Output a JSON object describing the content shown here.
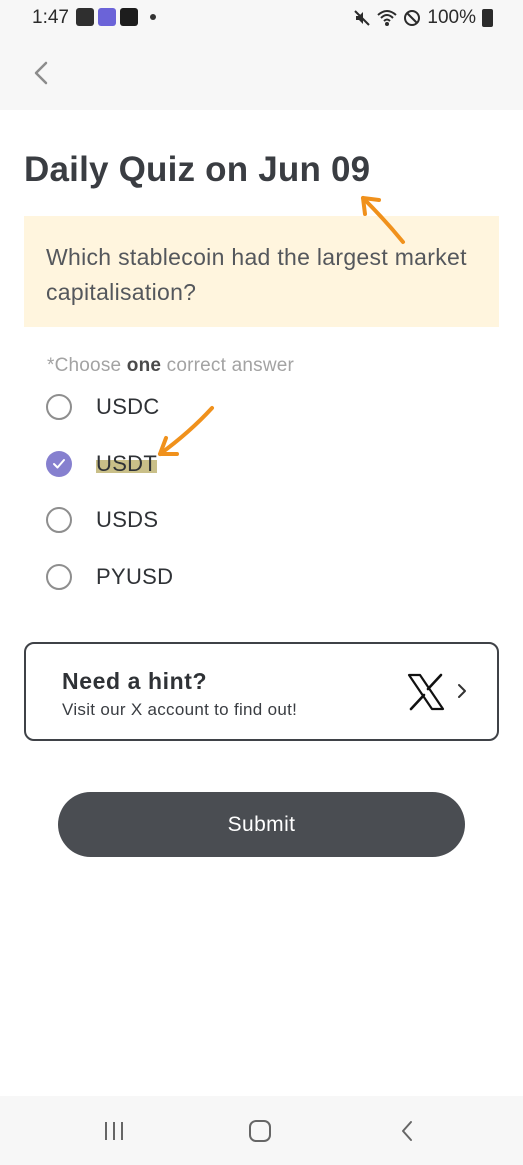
{
  "status_bar": {
    "time": "1:47",
    "battery": "100%",
    "icons_left": [
      "gallery-icon",
      "app-icon",
      "app-icon",
      "dot-icon"
    ],
    "icons_right": [
      "mute-icon",
      "wifi-icon",
      "dnd-icon",
      "battery-icon"
    ]
  },
  "header": {
    "back_icon": "chevron-left-icon"
  },
  "quiz": {
    "title": "Daily Quiz on Jun 09",
    "question": "Which stablecoin had the largest market capitalisation?",
    "instruction_prefix": "*Choose ",
    "instruction_emphasis": "one",
    "instruction_suffix": " correct answer",
    "options": [
      {
        "label": "USDC",
        "selected": false
      },
      {
        "label": "USDT",
        "selected": true
      },
      {
        "label": "USDS",
        "selected": false
      },
      {
        "label": "PYUSD",
        "selected": false
      }
    ]
  },
  "hint": {
    "title": "Need a hint?",
    "subtitle": "Visit our X account to find out!",
    "icon": "x-logo-icon"
  },
  "submit_label": "Submit",
  "nav": [
    "recents-icon",
    "home-icon",
    "back-icon"
  ],
  "colors": {
    "accent": "#8680cf",
    "question_bg": "#fff5de",
    "button_bg": "#4a4d52",
    "annotation": "#f0911c"
  }
}
